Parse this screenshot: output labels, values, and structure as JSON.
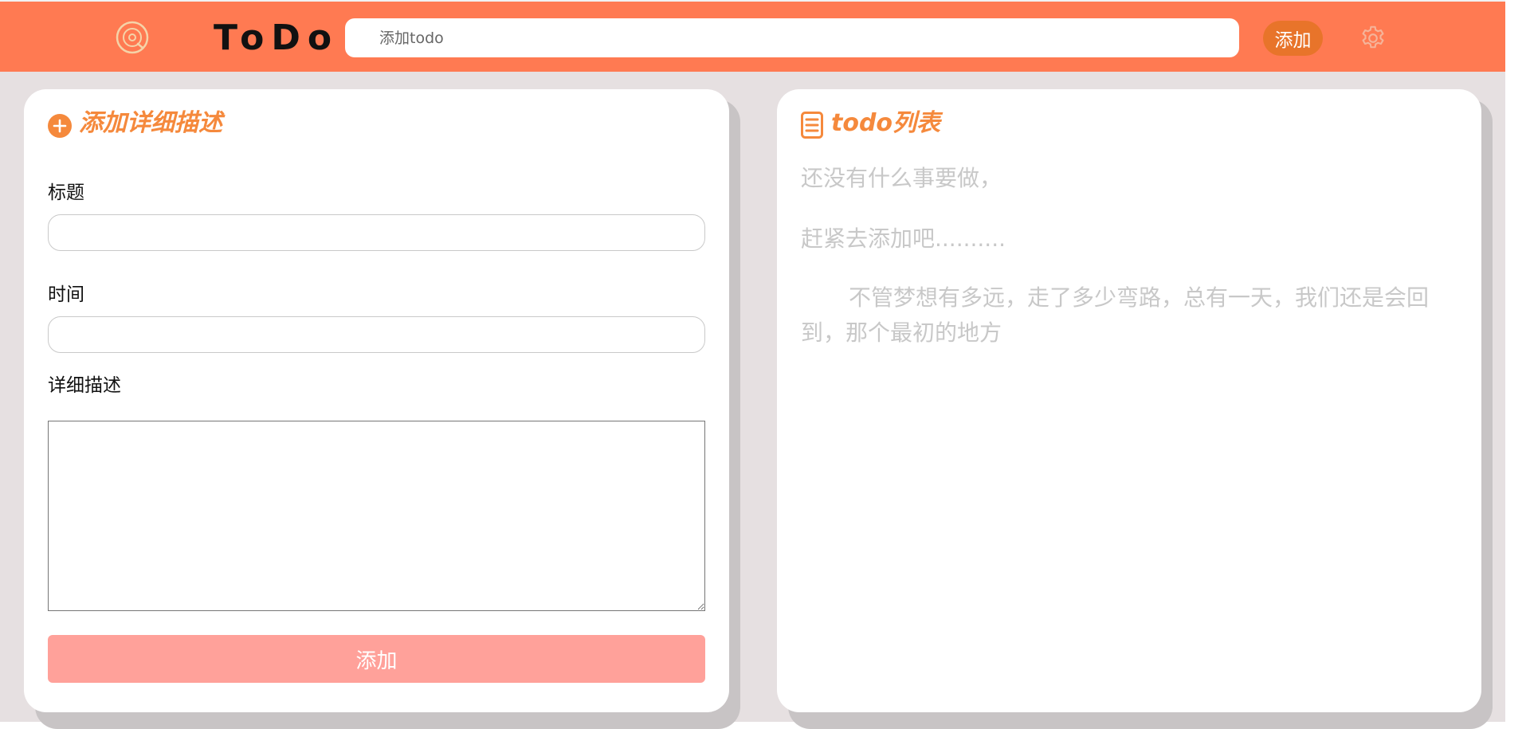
{
  "header": {
    "logo_icon": "vinyl-disc-icon",
    "brand": "ToDo",
    "search_placeholder": "添加todo",
    "add_label": "添加",
    "settings_icon": "gear-icon"
  },
  "form_panel": {
    "title": "添加详细描述",
    "title_icon": "plus-circle-icon",
    "fields": {
      "title_label": "标题",
      "title_value": "",
      "time_label": "时间",
      "time_value": "",
      "desc_label": "详细描述",
      "desc_value": ""
    },
    "submit_label": "添加"
  },
  "list_panel": {
    "title": "todo列表",
    "title_icon": "list-document-icon",
    "empty_line1": "还没有什么事要做，",
    "empty_line2": "赶紧去添加吧..........",
    "empty_quote": "不管梦想有多远，走了多少弯路，总有一天，我们还是会回到，那个最初的地方"
  },
  "colors": {
    "header_bg": "#ff7a52",
    "accent": "#f5893c",
    "header_button": "#e8742a",
    "submit_button": "#ffa19a",
    "page_bg": "#e6e0e1"
  }
}
